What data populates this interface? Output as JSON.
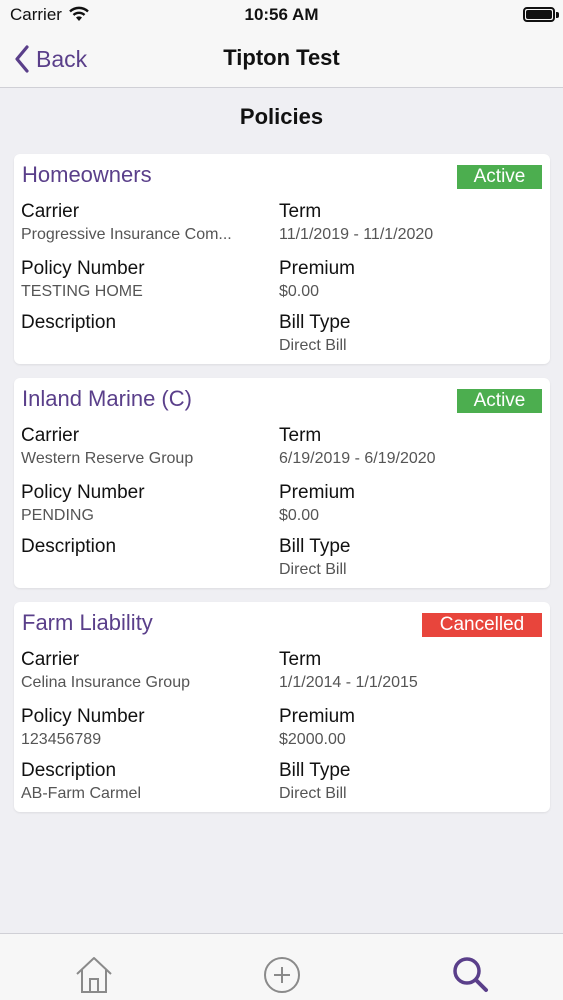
{
  "status_bar": {
    "carrier": "Carrier",
    "time": "10:56 AM"
  },
  "nav": {
    "back_label": "Back",
    "title": "Tipton Test"
  },
  "section_title": "Policies",
  "labels": {
    "carrier": "Carrier",
    "term": "Term",
    "policy_number": "Policy Number",
    "premium": "Premium",
    "description": "Description",
    "bill_type": "Bill Type"
  },
  "policies": [
    {
      "name": "Homeowners",
      "status": "Active",
      "carrier": "Progressive Insurance Com...",
      "term": "11/1/2019 - 11/1/2020",
      "policy_number": "TESTING HOME",
      "premium": "$0.00",
      "description": "",
      "bill_type": "Direct Bill"
    },
    {
      "name": "Inland Marine (C)",
      "status": "Active",
      "carrier": "Western Reserve Group",
      "term": "6/19/2019 - 6/19/2020",
      "policy_number": "PENDING",
      "premium": "$0.00",
      "description": "",
      "bill_type": "Direct Bill"
    },
    {
      "name": "Farm Liability",
      "status": "Cancelled",
      "carrier": "Celina Insurance Group",
      "term": "1/1/2014 - 1/1/2015",
      "policy_number": "123456789",
      "premium": "$2000.00",
      "description": "AB-Farm Carmel",
      "bill_type": "Direct Bill"
    }
  ],
  "colors": {
    "accent": "#5a3f8a",
    "active": "#4cae4f",
    "cancelled": "#e8453c"
  },
  "tab_bar": {
    "icons": [
      "home-icon",
      "add-circle-icon",
      "search-icon"
    ],
    "selected": "search-icon"
  }
}
